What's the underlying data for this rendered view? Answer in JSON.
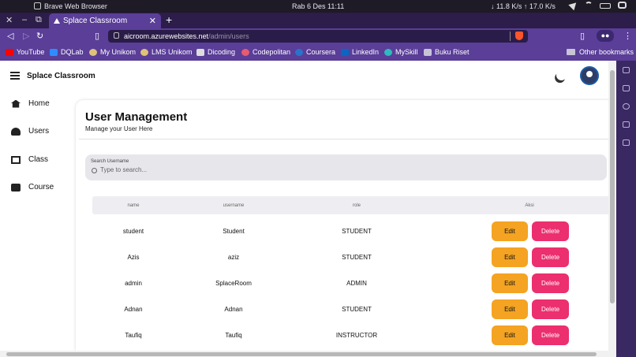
{
  "menubar": {
    "app_name": "Brave Web Browser",
    "clock": "Rab  6 Des  11:11",
    "network": "↓ 11.8 K/s ↑ 17.0 K/s"
  },
  "tab": {
    "title": "Splace Classroom"
  },
  "address": {
    "host": "aicroom.azurewebsites.net",
    "path": "/admin/users"
  },
  "bookmarks": [
    {
      "label": "YouTube",
      "color": "#ff0000"
    },
    {
      "label": "DQLab",
      "color": "#2f8cff"
    },
    {
      "label": "My Unikom",
      "color": "#e0c27a"
    },
    {
      "label": "LMS Unikom",
      "color": "#e0c27a"
    },
    {
      "label": "Dicoding",
      "color": "#dddddd"
    },
    {
      "label": "Codepolitan",
      "color": "#e95b6f"
    },
    {
      "label": "Coursera",
      "color": "#2a73cc"
    },
    {
      "label": "LinkedIn",
      "color": "#0a66c2"
    },
    {
      "label": "MySkill",
      "color": "#2fb9c0"
    },
    {
      "label": "Buku Riset",
      "color": "#c8c3d6"
    }
  ],
  "other_bookmarks": "Other bookmarks",
  "app": {
    "brand": "Splace Classroom"
  },
  "nav": [
    {
      "label": "Home"
    },
    {
      "label": "Users"
    },
    {
      "label": "Class"
    },
    {
      "label": "Course"
    }
  ],
  "card": {
    "title": "User Management",
    "subtitle": "Manage your User Here"
  },
  "search": {
    "label": "Search Username",
    "placeholder": "Type to search..."
  },
  "table": {
    "headers": [
      "name",
      "username",
      "role",
      "Aksi"
    ],
    "edit_label": "Edit",
    "delete_label": "Delete",
    "rows": [
      {
        "name": "student",
        "username": "Student",
        "role": "STUDENT"
      },
      {
        "name": "Azis",
        "username": "aziz",
        "role": "STUDENT"
      },
      {
        "name": "admin",
        "username": "SplaceRoom",
        "role": "ADMIN"
      },
      {
        "name": "Adnan",
        "username": "Adnan",
        "role": "STUDENT"
      },
      {
        "name": "Taufiq",
        "username": "Taufiq",
        "role": "INSTRUCTOR"
      }
    ]
  }
}
